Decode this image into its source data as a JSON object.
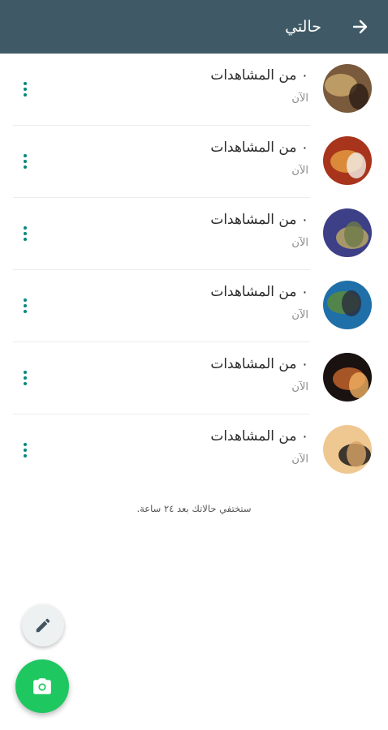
{
  "header": {
    "title": "حالتي",
    "back_icon": "arrow-right-icon"
  },
  "statuses": [
    {
      "views": "٠ من المشاهدات",
      "time": "الآن",
      "avatar_colors": [
        "#7a5a3c",
        "#c9a76b",
        "#2a1c14"
      ]
    },
    {
      "views": "٠ من المشاهدات",
      "time": "الآن",
      "avatar_colors": [
        "#a8341c",
        "#e39a3e",
        "#f2efe8"
      ]
    },
    {
      "views": "٠ من المشاهدات",
      "time": "الآن",
      "avatar_colors": [
        "#3d3f87",
        "#b8a766",
        "#6d7a4a"
      ]
    },
    {
      "views": "٠ من المشاهدات",
      "time": "الآن",
      "avatar_colors": [
        "#1f6fa8",
        "#5a8a3c",
        "#2c2c3c"
      ]
    },
    {
      "views": "٠ من المشاهدات",
      "time": "الآن",
      "avatar_colors": [
        "#1a1210",
        "#c0612a",
        "#f0b060"
      ]
    },
    {
      "views": "٠ من المشاهدات",
      "time": "الآن",
      "avatar_colors": [
        "#efc891",
        "#1c1c1c",
        "#d9a566"
      ]
    }
  ],
  "footnote": "ستختفي حالاتك بعد ٢٤ ساعة.",
  "fabs": {
    "pencil_icon": "pencil-icon",
    "camera_icon": "camera-icon"
  },
  "colors": {
    "appbar": "#3f5a66",
    "accent": "#00897b",
    "camera_fab": "#1ec760"
  }
}
